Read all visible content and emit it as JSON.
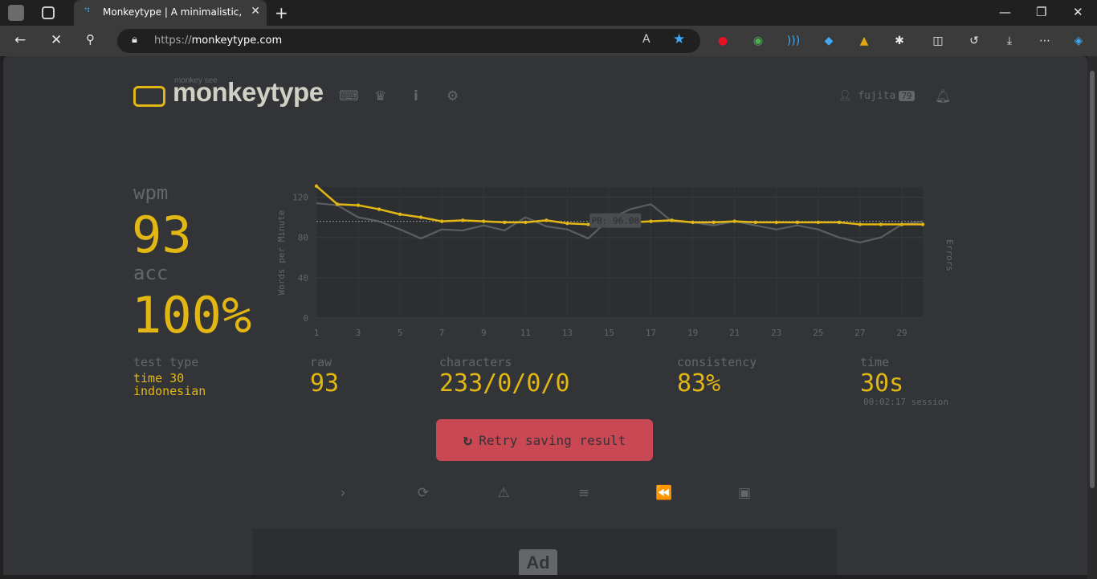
{
  "browser": {
    "tab_title": "Monkeytype | A minimalistic, cust",
    "url_protocol": "https://",
    "url_domain": "monkeytype.com"
  },
  "header": {
    "logo_sub": "monkey see",
    "logo": "monkeytype",
    "username": "fujita",
    "level": "79"
  },
  "stats": {
    "wpm_label": "wpm",
    "wpm": "93",
    "acc_label": "acc",
    "acc": "100%",
    "test_type_label": "test type",
    "test_type_line1": "time 30",
    "test_type_line2": "indonesian",
    "raw_label": "raw",
    "raw": "93",
    "characters_label": "characters",
    "characters": "233/0/0/0",
    "consistency_label": "consistency",
    "consistency": "83%",
    "time_label": "time",
    "time": "30s",
    "session": "00:02:17 session"
  },
  "retry_label": "Retry saving result",
  "ad_label": "Ad",
  "chart_data": {
    "type": "line",
    "ylabel": "Words per Minute",
    "y2label": "Errors",
    "ylim": [
      0,
      130
    ],
    "yticks": [
      0,
      40,
      80,
      120
    ],
    "xticks": [
      1,
      3,
      5,
      7,
      9,
      11,
      13,
      15,
      17,
      19,
      21,
      23,
      25,
      27,
      29
    ],
    "pb_label": "PB: 96.00",
    "pb_value": 96,
    "x": [
      1,
      2,
      3,
      4,
      5,
      6,
      7,
      8,
      9,
      10,
      11,
      12,
      13,
      14,
      15,
      16,
      17,
      18,
      19,
      20,
      21,
      22,
      23,
      24,
      25,
      26,
      27,
      28,
      29,
      30
    ],
    "series": [
      {
        "name": "wpm",
        "color": "#e2b714",
        "values": [
          131,
          113,
          112,
          108,
          103,
          100,
          96,
          97,
          96,
          95,
          95,
          97,
          94,
          93,
          95,
          95,
          96,
          97,
          95,
          95,
          96,
          95,
          95,
          95,
          95,
          95,
          93,
          93,
          93,
          93
        ]
      },
      {
        "name": "raw",
        "color": "#646669",
        "values": [
          114,
          112,
          100,
          96,
          88,
          79,
          88,
          87,
          92,
          87,
          100,
          91,
          88,
          79,
          98,
          108,
          113,
          96,
          95,
          92,
          96,
          92,
          88,
          92,
          88,
          80,
          75,
          80,
          93,
          96
        ]
      }
    ]
  },
  "colors": {
    "bg": "#323437",
    "main": "#e2b714",
    "sub": "#646669",
    "error": "#ca4754"
  }
}
